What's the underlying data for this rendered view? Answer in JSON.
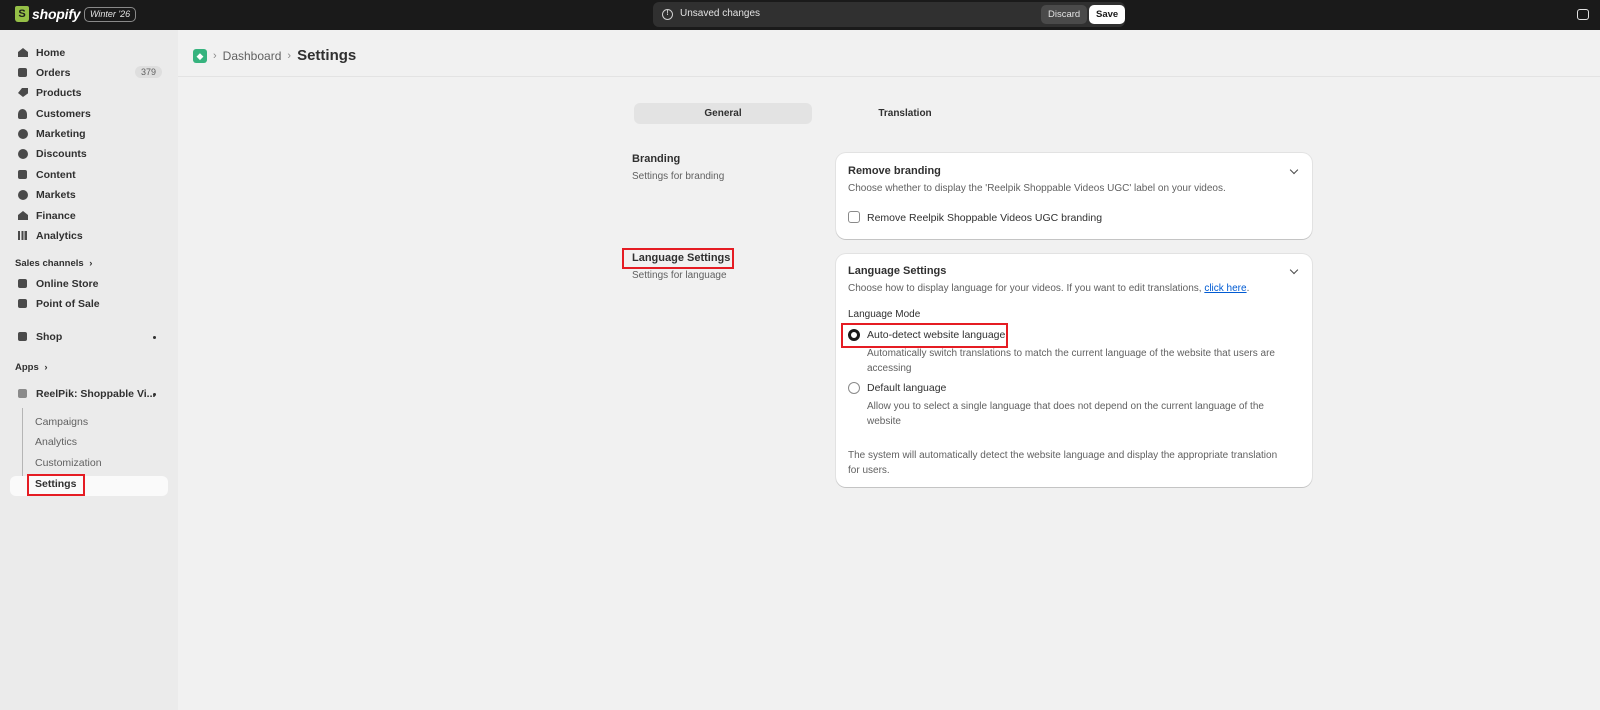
{
  "topbar": {
    "logo_glyph": "S",
    "logo_word": "shopify",
    "edition_badge": "Winter '26",
    "unsaved_text": "Unsaved changes",
    "discard_label": "Discard",
    "save_label": "Save"
  },
  "sidebar": {
    "nav": [
      {
        "label": "Home",
        "icon": "home-icon"
      },
      {
        "label": "Orders",
        "icon": "orders-icon",
        "count": "379"
      },
      {
        "label": "Products",
        "icon": "tag-icon"
      },
      {
        "label": "Customers",
        "icon": "person-icon"
      },
      {
        "label": "Marketing",
        "icon": "target-icon"
      },
      {
        "label": "Discounts",
        "icon": "discount-icon"
      },
      {
        "label": "Content",
        "icon": "content-icon"
      },
      {
        "label": "Markets",
        "icon": "globe-icon"
      },
      {
        "label": "Finance",
        "icon": "bank-icon"
      },
      {
        "label": "Analytics",
        "icon": "bar-chart-icon"
      }
    ],
    "sales_channels_label": "Sales channels",
    "sales_channels": [
      {
        "label": "Online Store",
        "icon": "store-icon"
      },
      {
        "label": "Point of Sale",
        "icon": "pos-icon"
      }
    ],
    "shop_label": "Shop",
    "apps_label": "Apps",
    "app_name": "ReelPik: Shoppable Vi...",
    "app_sub": [
      "Campaigns",
      "Analytics",
      "Customization",
      "Settings"
    ]
  },
  "breadcrumb": {
    "parent": "Dashboard",
    "current": "Settings"
  },
  "tabs": {
    "general": "General",
    "translation": "Translation"
  },
  "branding": {
    "section_title": "Branding",
    "section_desc": "Settings for branding",
    "card_title": "Remove branding",
    "card_desc": "Choose whether to display the 'Reelpik Shoppable Videos UGC' label on your videos.",
    "checkbox_label": "Remove Reelpik Shoppable Videos UGC branding"
  },
  "language": {
    "section_title": "Language Settings",
    "section_desc": "Settings for language",
    "card_title": "Language Settings",
    "card_desc_prefix": "Choose how to display language for your videos. If you want to edit translations, ",
    "card_desc_link": "click here",
    "card_desc_suffix": ".",
    "mode_label": "Language Mode",
    "option_auto_label": "Auto-detect website language",
    "option_auto_desc_1": "Automatically switch translations to match the current language of the website that users are",
    "option_auto_desc_2": "accessing",
    "option_default_label": "Default language",
    "option_default_desc_1": "Allow you to select a single language that does not depend on the current language of the",
    "option_default_desc_2": "website",
    "footer_1": "The system will automatically detect the website language and display the appropriate translation",
    "footer_2": "for users.",
    "selected_option": "auto"
  },
  "colors": {
    "highlight": "#e51c23",
    "link": "#005bd3",
    "topbar": "#1a1a1a"
  }
}
